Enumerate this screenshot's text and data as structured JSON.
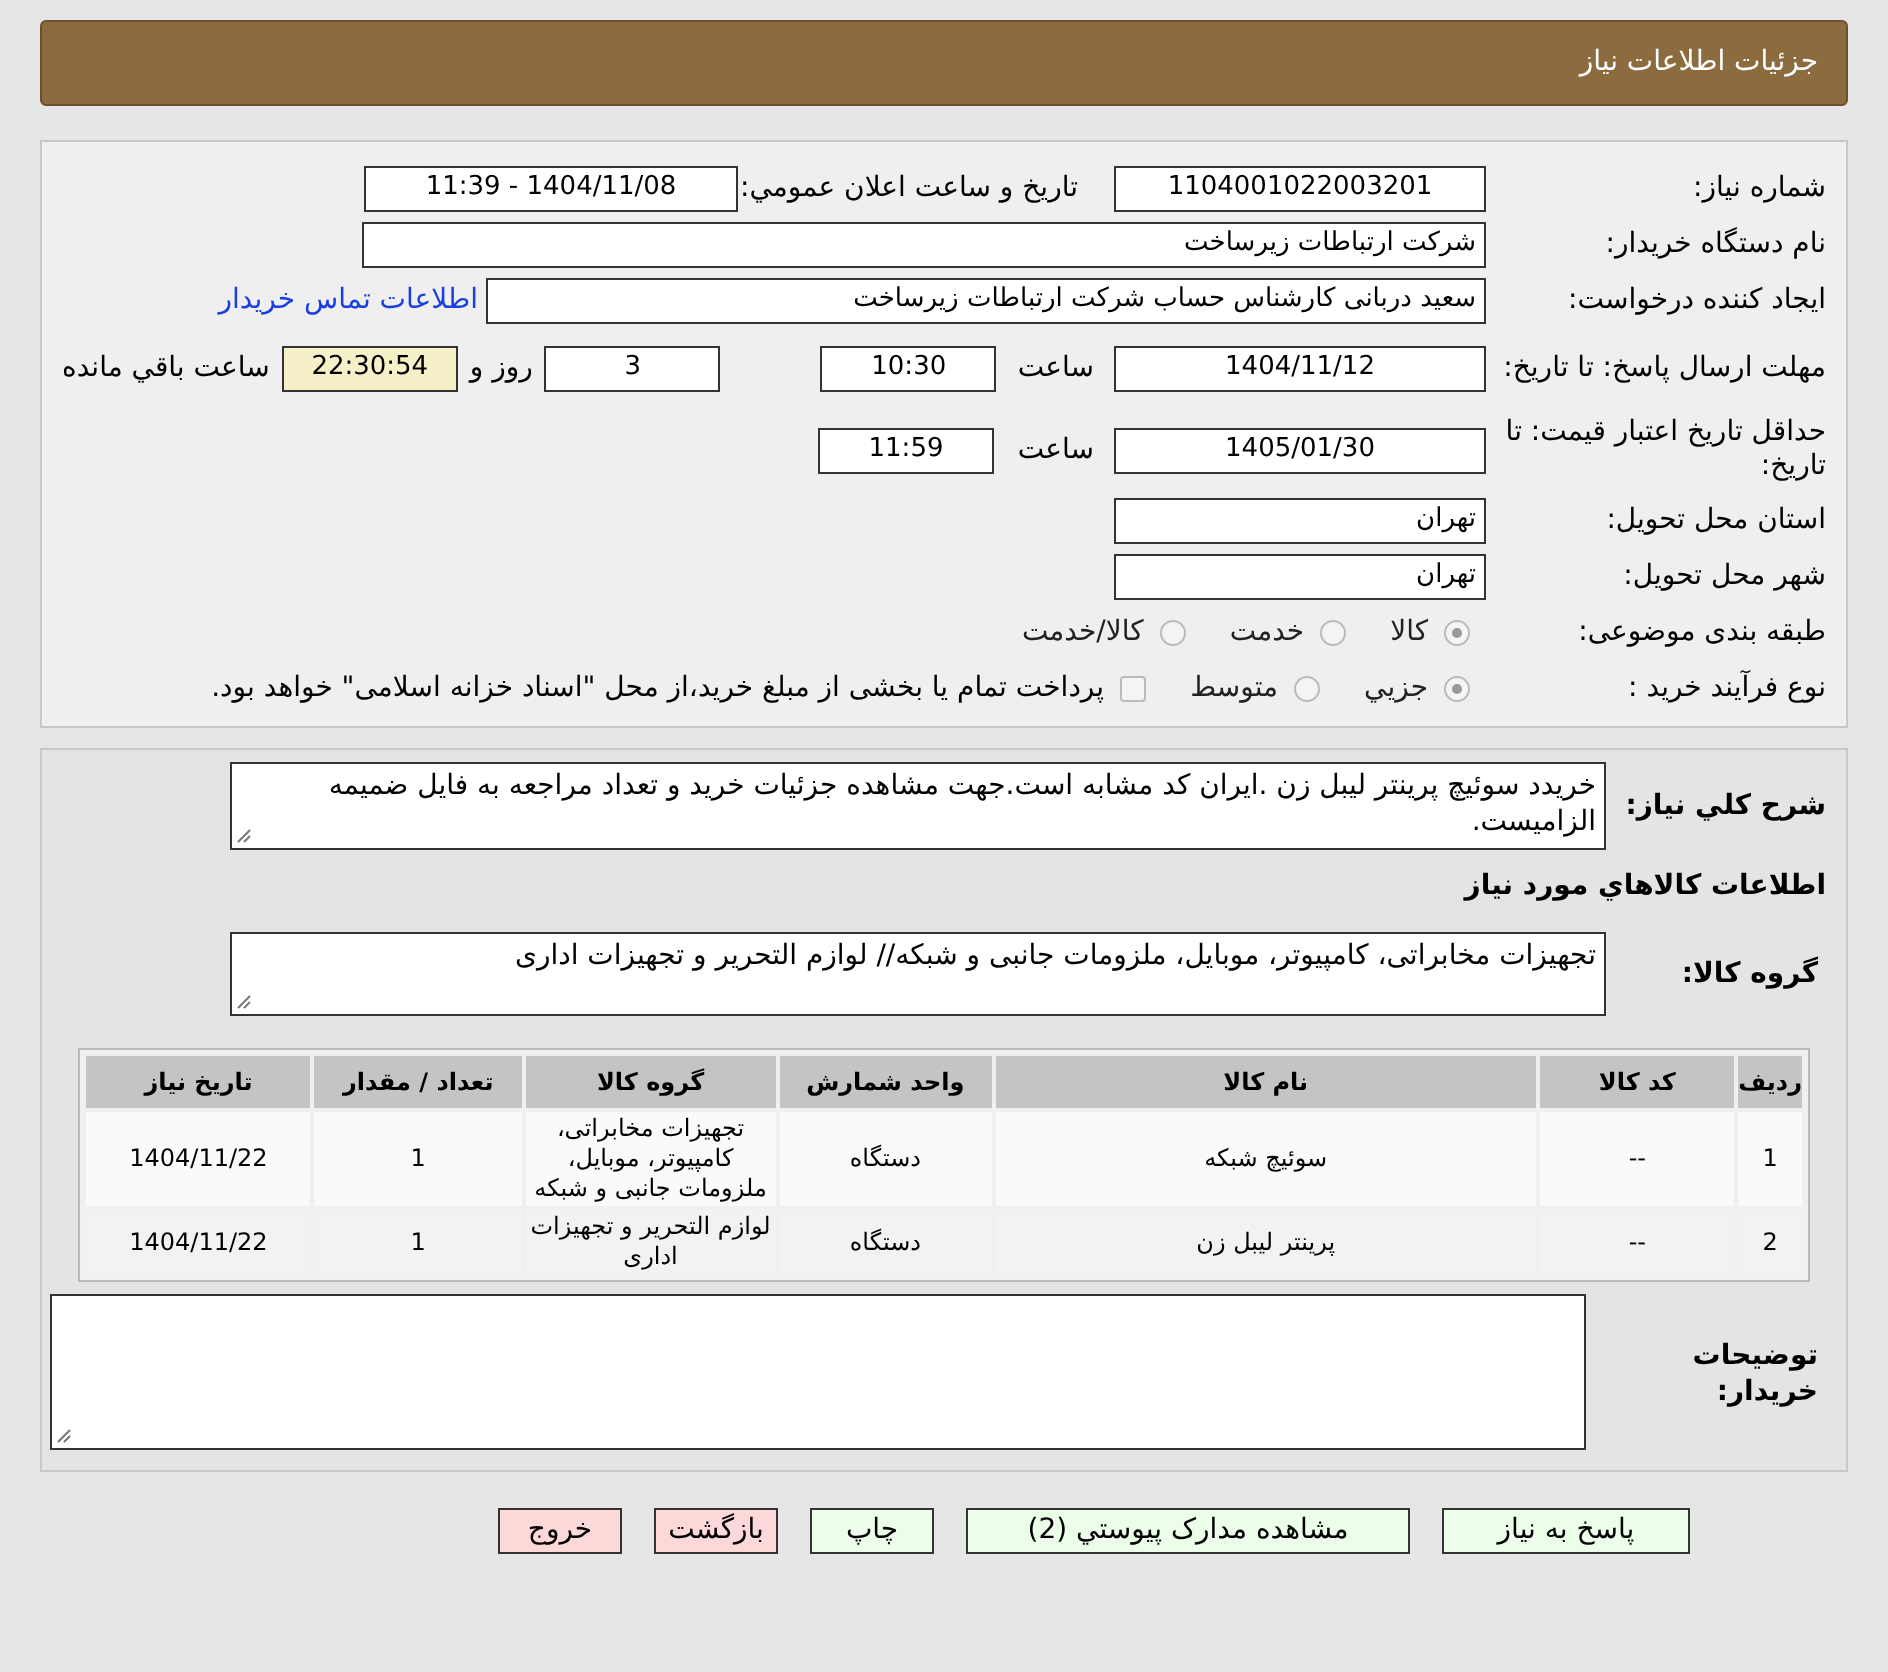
{
  "header": {
    "title": "جزئیات اطلاعات نیاز"
  },
  "need_number": {
    "label": "شماره نیاز:",
    "value": "1104001022003201"
  },
  "announce": {
    "label": "تاریخ و ساعت اعلان عمومي:",
    "value": "1404/11/08 - 11:39"
  },
  "buyer_org": {
    "label": "نام دستگاه خریدار:",
    "value": "شرکت ارتباطات زیرساخت"
  },
  "requester": {
    "label": "ایجاد کننده درخواست:",
    "value": "سعید دربانی کارشناس حساب  شرکت ارتباطات زیرساخت",
    "link": "اطلاعات تماس خریدار"
  },
  "reply_deadline": {
    "label": "مهلت ارسال پاسخ: تا تاریخ:",
    "date": "1404/11/12",
    "time_label": "ساعت",
    "time": "10:30",
    "days": "3",
    "days_label": "روز و",
    "remaining": "22:30:54",
    "remaining_label": "ساعت باقي مانده"
  },
  "price_validity": {
    "label": "حداقل تاریخ اعتبار قیمت: تا تاریخ:",
    "date": "1405/01/30",
    "time_label": "ساعت",
    "time": "11:59"
  },
  "province": {
    "label": "استان محل تحویل:",
    "value": "تهران"
  },
  "city": {
    "label": "شهر محل تحویل:",
    "value": "تهران"
  },
  "category": {
    "label": "طبقه بندی موضوعی:",
    "options": [
      {
        "label": "کالا",
        "selected": true
      },
      {
        "label": "خدمت",
        "selected": false
      },
      {
        "label": "کالا/خدمت",
        "selected": false
      }
    ]
  },
  "process": {
    "label": "نوع فرآیند خرید :",
    "options": [
      {
        "label": "جزيي",
        "selected": true
      },
      {
        "label": "متوسط",
        "selected": false
      }
    ],
    "treasury": {
      "label": "پرداخت تمام یا بخشی از مبلغ خرید،از محل \"اسناد خزانه اسلامی\" خواهد بود.",
      "checked": false
    }
  },
  "description": {
    "label": "شرح کلي نياز:",
    "value": "خريدد سوئيچ پرينتر ليبل زن .ايران كد مشابه است.جهت مشاهده جزئيات خريد و تعداد مراجعه به فايل ضميمه الزاميست."
  },
  "goods_title": "اطلاعات کالاهاي مورد نياز",
  "goods_group": {
    "label": "گروه کالا:",
    "value": "تجهیزات مخابراتی، کامپیوتر، موبایل، ملزومات جانبی و شبکه// لوازم التحریر و تجهیزات اداری"
  },
  "table": {
    "columns": [
      "ردیف",
      "کد کالا",
      "نام کالا",
      "واحد شمارش",
      "گروه کالا",
      "تعداد / مقدار",
      "تاریخ نیاز"
    ],
    "rows": [
      [
        "1",
        "--",
        "سوئیچ شبکه",
        "دستگاه",
        "تجهیزات مخابراتی، کامپیوتر، موبایل، ملزومات جانبی و شبکه",
        "1",
        "1404/11/22"
      ],
      [
        "2",
        "--",
        "پرینتر لیبل زن",
        "دستگاه",
        "لوازم التحریر و تجهیزات اداری",
        "1",
        "1404/11/22"
      ]
    ]
  },
  "buyer_notes": {
    "label": "توضیحات خریدار:"
  },
  "buttons": [
    {
      "label": "پاسخ به نیاز",
      "kind": "primary"
    },
    {
      "label": "مشاهده مدارک پیوستي (2)",
      "kind": "primary"
    },
    {
      "label": "چاپ",
      "kind": "primary"
    },
    {
      "label": "بازگشت",
      "kind": "danger"
    },
    {
      "label": "خروج",
      "kind": "danger"
    }
  ]
}
